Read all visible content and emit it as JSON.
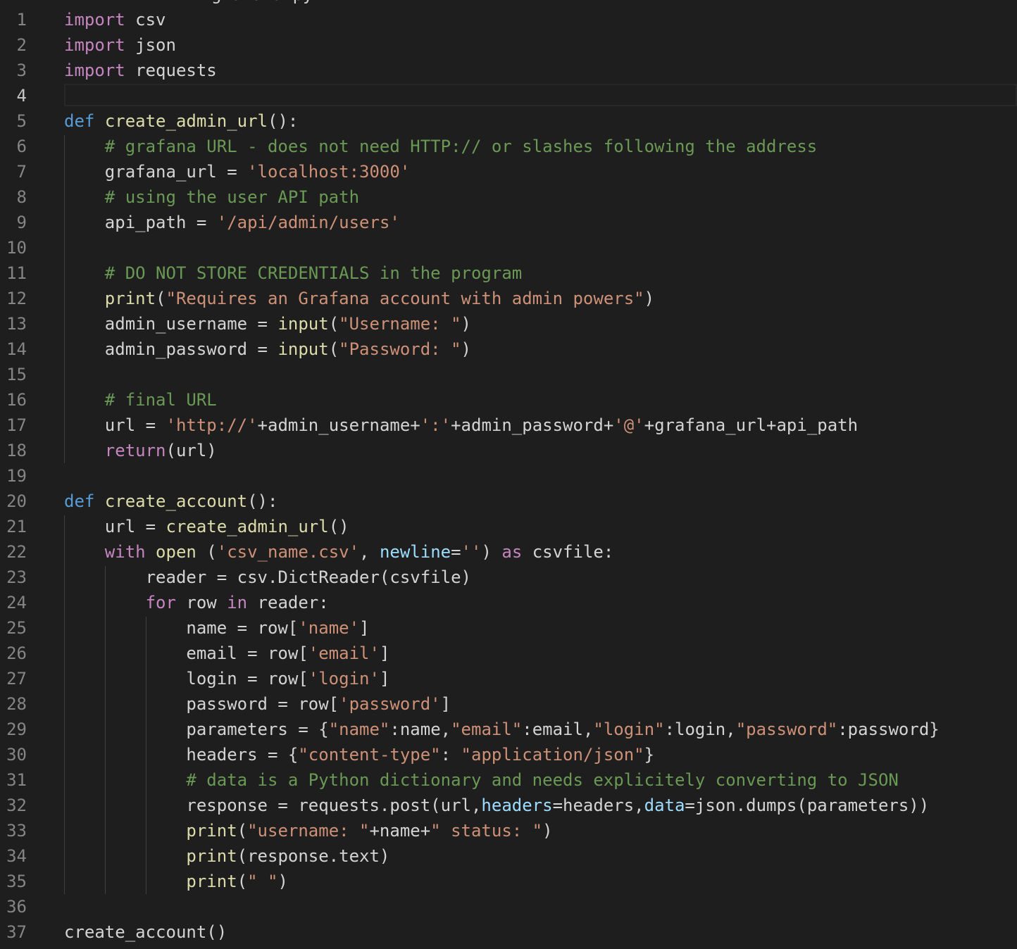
{
  "editor": {
    "active_line": 4,
    "top_cut_text": "grafana.py",
    "colors": {
      "background": "#1e1e1e",
      "keyword": "#c586c0",
      "def": "#569cd6",
      "function": "#dcdcaa",
      "string": "#ce9178",
      "comment": "#6a9955",
      "param": "#9cdcfe",
      "text": "#d4d4d4",
      "line_number": "#858585"
    },
    "lines": [
      {
        "n": "1",
        "tokens": [
          [
            "kw",
            "import"
          ],
          [
            "plain",
            " csv"
          ]
        ]
      },
      {
        "n": "2",
        "tokens": [
          [
            "kw",
            "import"
          ],
          [
            "plain",
            " json"
          ]
        ]
      },
      {
        "n": "3",
        "tokens": [
          [
            "kw",
            "import"
          ],
          [
            "plain",
            " requests"
          ]
        ]
      },
      {
        "n": "4",
        "tokens": []
      },
      {
        "n": "5",
        "tokens": [
          [
            "def",
            "def"
          ],
          [
            "plain",
            " "
          ],
          [
            "fn",
            "create_admin_url"
          ],
          [
            "plain",
            "():"
          ]
        ]
      },
      {
        "n": "6",
        "tokens": [
          [
            "plain",
            "    "
          ],
          [
            "cm",
            "# grafana URL - does not need HTTP:// or slashes following the address"
          ]
        ]
      },
      {
        "n": "7",
        "tokens": [
          [
            "plain",
            "    grafana_url = "
          ],
          [
            "str",
            "'localhost:3000'"
          ]
        ]
      },
      {
        "n": "8",
        "tokens": [
          [
            "plain",
            "    "
          ],
          [
            "cm",
            "# using the user API path"
          ]
        ]
      },
      {
        "n": "9",
        "tokens": [
          [
            "plain",
            "    api_path = "
          ],
          [
            "str",
            "'/api/admin/users'"
          ]
        ]
      },
      {
        "n": "10",
        "tokens": []
      },
      {
        "n": "11",
        "tokens": [
          [
            "plain",
            "    "
          ],
          [
            "cm",
            "# DO NOT STORE CREDENTIALS in the program"
          ]
        ]
      },
      {
        "n": "12",
        "tokens": [
          [
            "plain",
            "    "
          ],
          [
            "fn",
            "print"
          ],
          [
            "plain",
            "("
          ],
          [
            "str",
            "\"Requires an Grafana account with admin powers\""
          ],
          [
            "plain",
            ")"
          ]
        ]
      },
      {
        "n": "13",
        "tokens": [
          [
            "plain",
            "    admin_username = "
          ],
          [
            "fn",
            "input"
          ],
          [
            "plain",
            "("
          ],
          [
            "str",
            "\"Username: \""
          ],
          [
            "plain",
            ")"
          ]
        ]
      },
      {
        "n": "14",
        "tokens": [
          [
            "plain",
            "    admin_password = "
          ],
          [
            "fn",
            "input"
          ],
          [
            "plain",
            "("
          ],
          [
            "str",
            "\"Password: \""
          ],
          [
            "plain",
            ")"
          ]
        ]
      },
      {
        "n": "15",
        "tokens": []
      },
      {
        "n": "16",
        "tokens": [
          [
            "plain",
            "    "
          ],
          [
            "cm",
            "# final URL"
          ]
        ]
      },
      {
        "n": "17",
        "tokens": [
          [
            "plain",
            "    url = "
          ],
          [
            "str",
            "'http://'"
          ],
          [
            "plain",
            "+admin_username+"
          ],
          [
            "str",
            "':'"
          ],
          [
            "plain",
            "+admin_password+"
          ],
          [
            "str",
            "'@'"
          ],
          [
            "plain",
            "+grafana_url+api_path"
          ]
        ]
      },
      {
        "n": "18",
        "tokens": [
          [
            "plain",
            "    "
          ],
          [
            "kw",
            "return"
          ],
          [
            "plain",
            "(url)"
          ]
        ]
      },
      {
        "n": "19",
        "tokens": []
      },
      {
        "n": "20",
        "tokens": [
          [
            "def",
            "def"
          ],
          [
            "plain",
            " "
          ],
          [
            "fn",
            "create_account"
          ],
          [
            "plain",
            "():"
          ]
        ]
      },
      {
        "n": "21",
        "tokens": [
          [
            "plain",
            "    url = "
          ],
          [
            "fn",
            "create_admin_url"
          ],
          [
            "plain",
            "()"
          ]
        ]
      },
      {
        "n": "22",
        "tokens": [
          [
            "plain",
            "    "
          ],
          [
            "kw",
            "with"
          ],
          [
            "plain",
            " "
          ],
          [
            "fn",
            "open"
          ],
          [
            "plain",
            " ("
          ],
          [
            "str",
            "'csv_name.csv'"
          ],
          [
            "plain",
            ", "
          ],
          [
            "param",
            "newline"
          ],
          [
            "plain",
            "="
          ],
          [
            "str",
            "''"
          ],
          [
            "plain",
            ") "
          ],
          [
            "kw",
            "as"
          ],
          [
            "plain",
            " csvfile:"
          ]
        ]
      },
      {
        "n": "23",
        "tokens": [
          [
            "plain",
            "        reader = csv.DictReader(csvfile)"
          ]
        ]
      },
      {
        "n": "24",
        "tokens": [
          [
            "plain",
            "        "
          ],
          [
            "kw",
            "for"
          ],
          [
            "plain",
            " row "
          ],
          [
            "kw",
            "in"
          ],
          [
            "plain",
            " reader:"
          ]
        ]
      },
      {
        "n": "25",
        "tokens": [
          [
            "plain",
            "            name = row["
          ],
          [
            "str",
            "'name'"
          ],
          [
            "plain",
            "]"
          ]
        ]
      },
      {
        "n": "26",
        "tokens": [
          [
            "plain",
            "            email = row["
          ],
          [
            "str",
            "'email'"
          ],
          [
            "plain",
            "]"
          ]
        ]
      },
      {
        "n": "27",
        "tokens": [
          [
            "plain",
            "            login = row["
          ],
          [
            "str",
            "'login'"
          ],
          [
            "plain",
            "]"
          ]
        ]
      },
      {
        "n": "28",
        "tokens": [
          [
            "plain",
            "            password = row["
          ],
          [
            "str",
            "'password'"
          ],
          [
            "plain",
            "]"
          ]
        ]
      },
      {
        "n": "29",
        "tokens": [
          [
            "plain",
            "            parameters = {"
          ],
          [
            "str",
            "\"name\""
          ],
          [
            "plain",
            ":name,"
          ],
          [
            "str",
            "\"email\""
          ],
          [
            "plain",
            ":email,"
          ],
          [
            "str",
            "\"login\""
          ],
          [
            "plain",
            ":login,"
          ],
          [
            "str",
            "\"password\""
          ],
          [
            "plain",
            ":password}"
          ]
        ]
      },
      {
        "n": "30",
        "tokens": [
          [
            "plain",
            "            headers = {"
          ],
          [
            "str",
            "\"content-type\""
          ],
          [
            "plain",
            ": "
          ],
          [
            "str",
            "\"application/json\""
          ],
          [
            "plain",
            "}"
          ]
        ]
      },
      {
        "n": "31",
        "tokens": [
          [
            "plain",
            "            "
          ],
          [
            "cm",
            "# data is a Python dictionary and needs explicitely converting to JSON"
          ]
        ]
      },
      {
        "n": "32",
        "tokens": [
          [
            "plain",
            "            response = requests.post(url,"
          ],
          [
            "param",
            "headers"
          ],
          [
            "plain",
            "=headers,"
          ],
          [
            "param",
            "data"
          ],
          [
            "plain",
            "=json.dumps(parameters))"
          ]
        ]
      },
      {
        "n": "33",
        "tokens": [
          [
            "plain",
            "            "
          ],
          [
            "fn",
            "print"
          ],
          [
            "plain",
            "("
          ],
          [
            "str",
            "\"username: \""
          ],
          [
            "plain",
            "+name+"
          ],
          [
            "str",
            "\" status: \""
          ],
          [
            "plain",
            ")"
          ]
        ]
      },
      {
        "n": "34",
        "tokens": [
          [
            "plain",
            "            "
          ],
          [
            "fn",
            "print"
          ],
          [
            "plain",
            "(response.text)"
          ]
        ]
      },
      {
        "n": "35",
        "tokens": [
          [
            "plain",
            "            "
          ],
          [
            "fn",
            "print"
          ],
          [
            "plain",
            "("
          ],
          [
            "str",
            "\" \""
          ],
          [
            "plain",
            ")"
          ]
        ]
      },
      {
        "n": "36",
        "tokens": []
      },
      {
        "n": "37",
        "tokens": [
          [
            "plain",
            "create_account()"
          ]
        ]
      }
    ]
  }
}
